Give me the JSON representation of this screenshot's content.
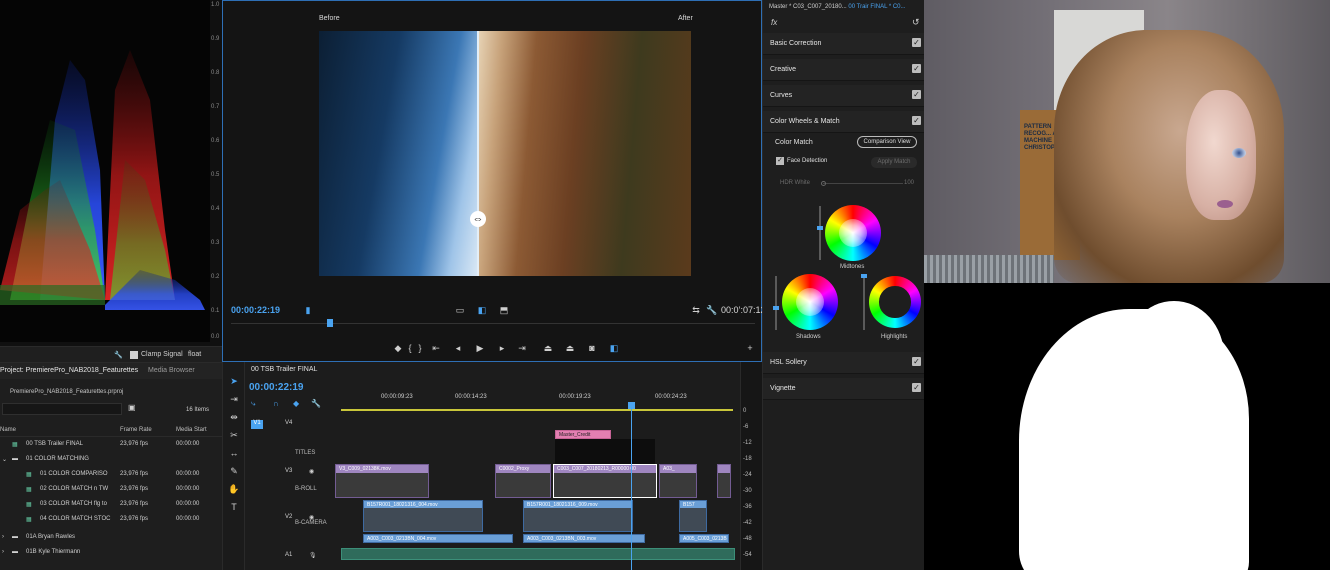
{
  "scopes": {
    "scale": [
      "1.0",
      "0.9",
      "0.8",
      "0.7",
      "0.6",
      "0.5",
      "0.4",
      "0.3",
      "0.2",
      "0.1",
      "0.0"
    ],
    "clamp_signal_label": "Clamp Signal",
    "float_label": "float"
  },
  "monitor": {
    "before_label": "Before",
    "after_label": "After",
    "timecode_left": "00:00:22:19",
    "timecode_right": "00:0’:07:12"
  },
  "lumetri": {
    "header_left": "Master * C03_C007_20180...",
    "header_right": "00 Trair FINAL * C0...",
    "fx_label": "fx",
    "sections": {
      "basic": "Basic Correction",
      "creative": "Creative",
      "curves": "Curves",
      "wheels": "Color Wheels & Match",
      "hsl": "HSL Sollery",
      "vignette": "Vignette"
    },
    "color_match_label": "Color Match",
    "comparison_view_label": "Comparison View",
    "face_detection_label": "Face Detection",
    "apply_match_label": "Apply Match",
    "hdr_white_label": "HDR White",
    "hdr_white_value": "100",
    "wheel_midtones": "Midtones",
    "wheel_shadows": "Shadows",
    "wheel_highlights": "Highlights"
  },
  "camera": {
    "book_text": "PATTERN RECOG... AND MACHINE LE... CHRISTOPHER"
  },
  "project": {
    "tab_project": "Project: PremierePro_NAB2018_Featurettes",
    "tab_media": "Media Browser",
    "path": "PremierePro_NAB2018_Featurettes.prproj",
    "items_count": "16 Items",
    "columns": {
      "name": "Name",
      "frame_rate": "Frame Rate",
      "media_start": "Media Start"
    },
    "rows": [
      {
        "name": "00 TSB Trailer FINAL",
        "fps": "23,976 fps",
        "start": "00:00:00"
      },
      {
        "name": "01 COLOR MATCHING",
        "fps": "",
        "start": ""
      },
      {
        "name": "01 COLOR COMPARISO",
        "fps": "23,976 fps",
        "start": "00:00:00"
      },
      {
        "name": "02 COLOR MATCH n TW",
        "fps": "23,976 fps",
        "start": "00:00:00"
      },
      {
        "name": "03 COLOR MATCH flg to",
        "fps": "23,976 fps",
        "start": "00:00:00"
      },
      {
        "name": "04 COLOR MATCH STOC",
        "fps": "23,976 fps",
        "start": "00:00:00"
      },
      {
        "name": "01A Bryan Rawles",
        "fps": "",
        "start": ""
      },
      {
        "name": "01B Kyle Thiermann",
        "fps": "",
        "start": ""
      }
    ]
  },
  "timeline": {
    "tab_label": "00 TSB Trailer FINAL",
    "timecode": "00:00:22:19",
    "ruler": [
      "00:00:09:23",
      "00:00:14:23",
      "00:00:19:23",
      "00:00:24:23"
    ],
    "tracks": {
      "v4": "V4",
      "v4_name": "TITLES",
      "v3": "V3",
      "v3_name": "B-ROLL",
      "v2": "V2",
      "v2_name": "B-CAMERA",
      "a1": "A1"
    },
    "clips": {
      "master_credit": "Master_Credit",
      "v3_a": "V3_C009_02138K.mov",
      "v3_b": "C0002_Proxy",
      "v3_c": "C003_C007_20180213_R00000 00",
      "v3_d": "A03_",
      "v2_a": "B157R001_18021316_004.mov",
      "v2_b": "B157R001_18021316_009.mov",
      "v2_c": "B157",
      "a1_a": "A003_C003_0213BN_004.mov",
      "a1_b": "A003_C003_0213BN_003.mov",
      "a1_c": "A005_C003_0213B"
    }
  },
  "meter": {
    "labels": [
      "0",
      "-6",
      "-12",
      "-18",
      "-24",
      "-30",
      "-36",
      "-42",
      "-48",
      "-54"
    ]
  }
}
